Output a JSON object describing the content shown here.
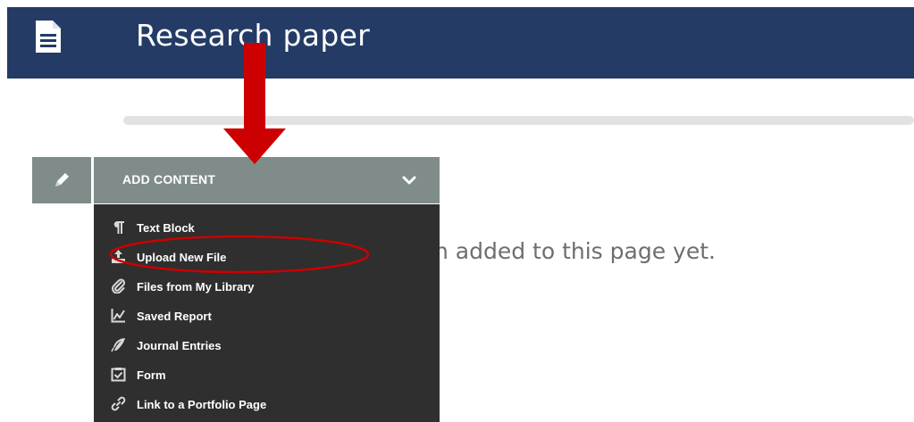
{
  "header": {
    "title": "Research paper",
    "icon": "document-icon",
    "background": "#243b66"
  },
  "progress": {
    "value": 0
  },
  "empty_state": {
    "message": "n added to this page yet."
  },
  "toolbar": {
    "edit_icon": "pencil-icon",
    "add_content_label": "ADD CONTENT",
    "add_content_icon": "chevron-down-icon",
    "color": "#7f8c8a"
  },
  "menu": {
    "background": "#2f2f2f",
    "items": [
      {
        "label": "Text Block",
        "icon": "paragraph-icon"
      },
      {
        "label": "Upload New File",
        "icon": "upload-icon"
      },
      {
        "label": "Files from My Library",
        "icon": "paperclip-icon"
      },
      {
        "label": "Saved Report",
        "icon": "line-chart-icon"
      },
      {
        "label": "Journal Entries",
        "icon": "feather-icon"
      },
      {
        "label": "Form",
        "icon": "checkbox-icon"
      },
      {
        "label": "Link to a Portfolio Page",
        "icon": "link-icon"
      }
    ]
  },
  "annotations": {
    "accent": "#cc0000"
  }
}
